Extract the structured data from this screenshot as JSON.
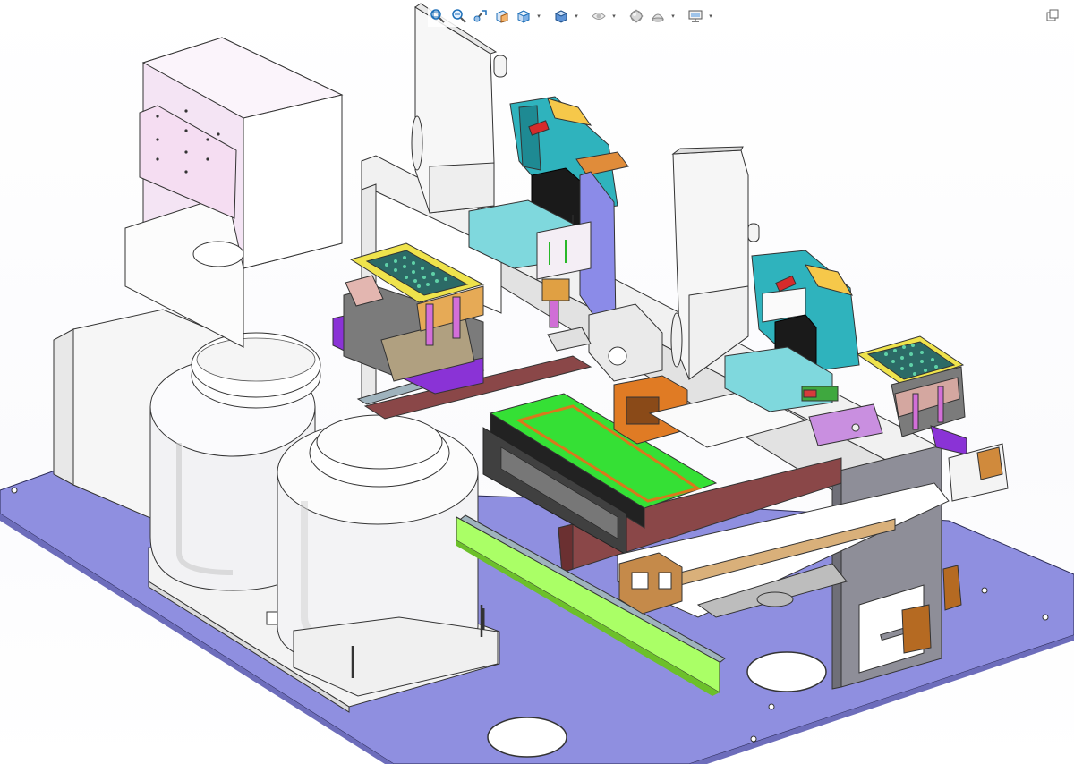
{
  "app": {
    "viewport": {
      "model": "automation-assembly-machine",
      "background_color": "#ffffff"
    },
    "heads_up_toolbar": {
      "tools": [
        {
          "icon": "zoom-to-fit-icon",
          "has_dropdown": false
        },
        {
          "icon": "zoom-to-area-icon",
          "has_dropdown": false
        },
        {
          "icon": "previous-view-icon",
          "has_dropdown": false
        },
        {
          "icon": "section-view-icon",
          "has_dropdown": false
        },
        {
          "icon": "view-orientation-icon",
          "has_dropdown": true
        },
        {
          "icon": "display-style-icon",
          "has_dropdown": true
        },
        {
          "icon": "hide-show-items-icon",
          "has_dropdown": true
        },
        {
          "icon": "edit-appearance-icon",
          "has_dropdown": true
        },
        {
          "icon": "apply-scene-icon",
          "has_dropdown": true
        },
        {
          "icon": "view-settings-icon",
          "has_dropdown": true
        }
      ]
    },
    "window_controls": {
      "icon": "restore-window-icon"
    },
    "colors": {
      "base_plate": "#8f8fe0",
      "frame_white": "#f1f1f1",
      "panel_pink": "#f1e6f2",
      "conveyor_green": "#33e533",
      "accent_teal": "#3bb9c1",
      "accent_orange": "#d9781c",
      "accent_purple": "#8a33d6",
      "rail_gray": "#9fb3bd",
      "fixture_yellow": "#eee44a",
      "column_gray": "#8e8e98",
      "rail_brown": "#8a4748"
    }
  }
}
